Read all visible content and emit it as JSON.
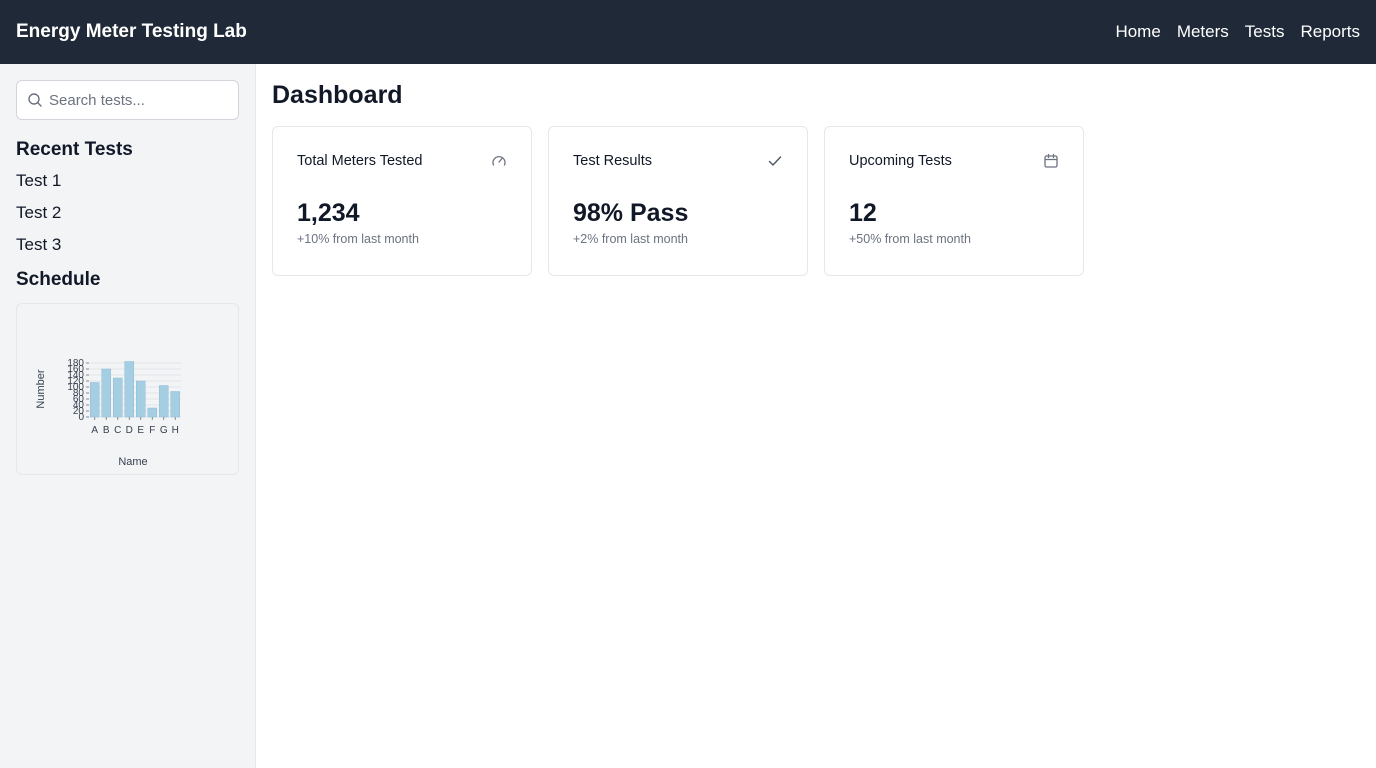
{
  "header": {
    "brand": "Energy Meter Testing Lab",
    "nav": [
      "Home",
      "Meters",
      "Tests",
      "Reports"
    ]
  },
  "sidebar": {
    "search_placeholder": "Search tests...",
    "recent_title": "Recent Tests",
    "recent_items": [
      "Test 1",
      "Test 2",
      "Test 3"
    ],
    "schedule_title": "Schedule"
  },
  "main": {
    "title": "Dashboard",
    "cards": [
      {
        "title": "Total Meters Tested",
        "icon": "gauge-icon",
        "value": "1,234",
        "sub": "+10% from last month"
      },
      {
        "title": "Test Results",
        "icon": "check-icon",
        "value": "98% Pass",
        "sub": "+2% from last month"
      },
      {
        "title": "Upcoming Tests",
        "icon": "calendar-icon",
        "value": "12",
        "sub": "+50% from last month"
      }
    ]
  },
  "chart_data": {
    "type": "bar",
    "categories": [
      "A",
      "B",
      "C",
      "D",
      "E",
      "F",
      "G",
      "H"
    ],
    "values": [
      115,
      160,
      130,
      185,
      120,
      30,
      105,
      85
    ],
    "xlabel": "Name",
    "ylabel": "Number",
    "yticks": [
      "0",
      "20",
      "40",
      "60",
      "80",
      "100",
      "120",
      "140",
      "160",
      "180"
    ],
    "ylim": [
      0,
      180
    ],
    "grid": true,
    "bar_color": "#a6cee3"
  },
  "colors": {
    "topbar": "#1f2937",
    "sidebar": "#f3f4f6",
    "border": "#e5e7eb",
    "muted_text": "#6b7280"
  }
}
